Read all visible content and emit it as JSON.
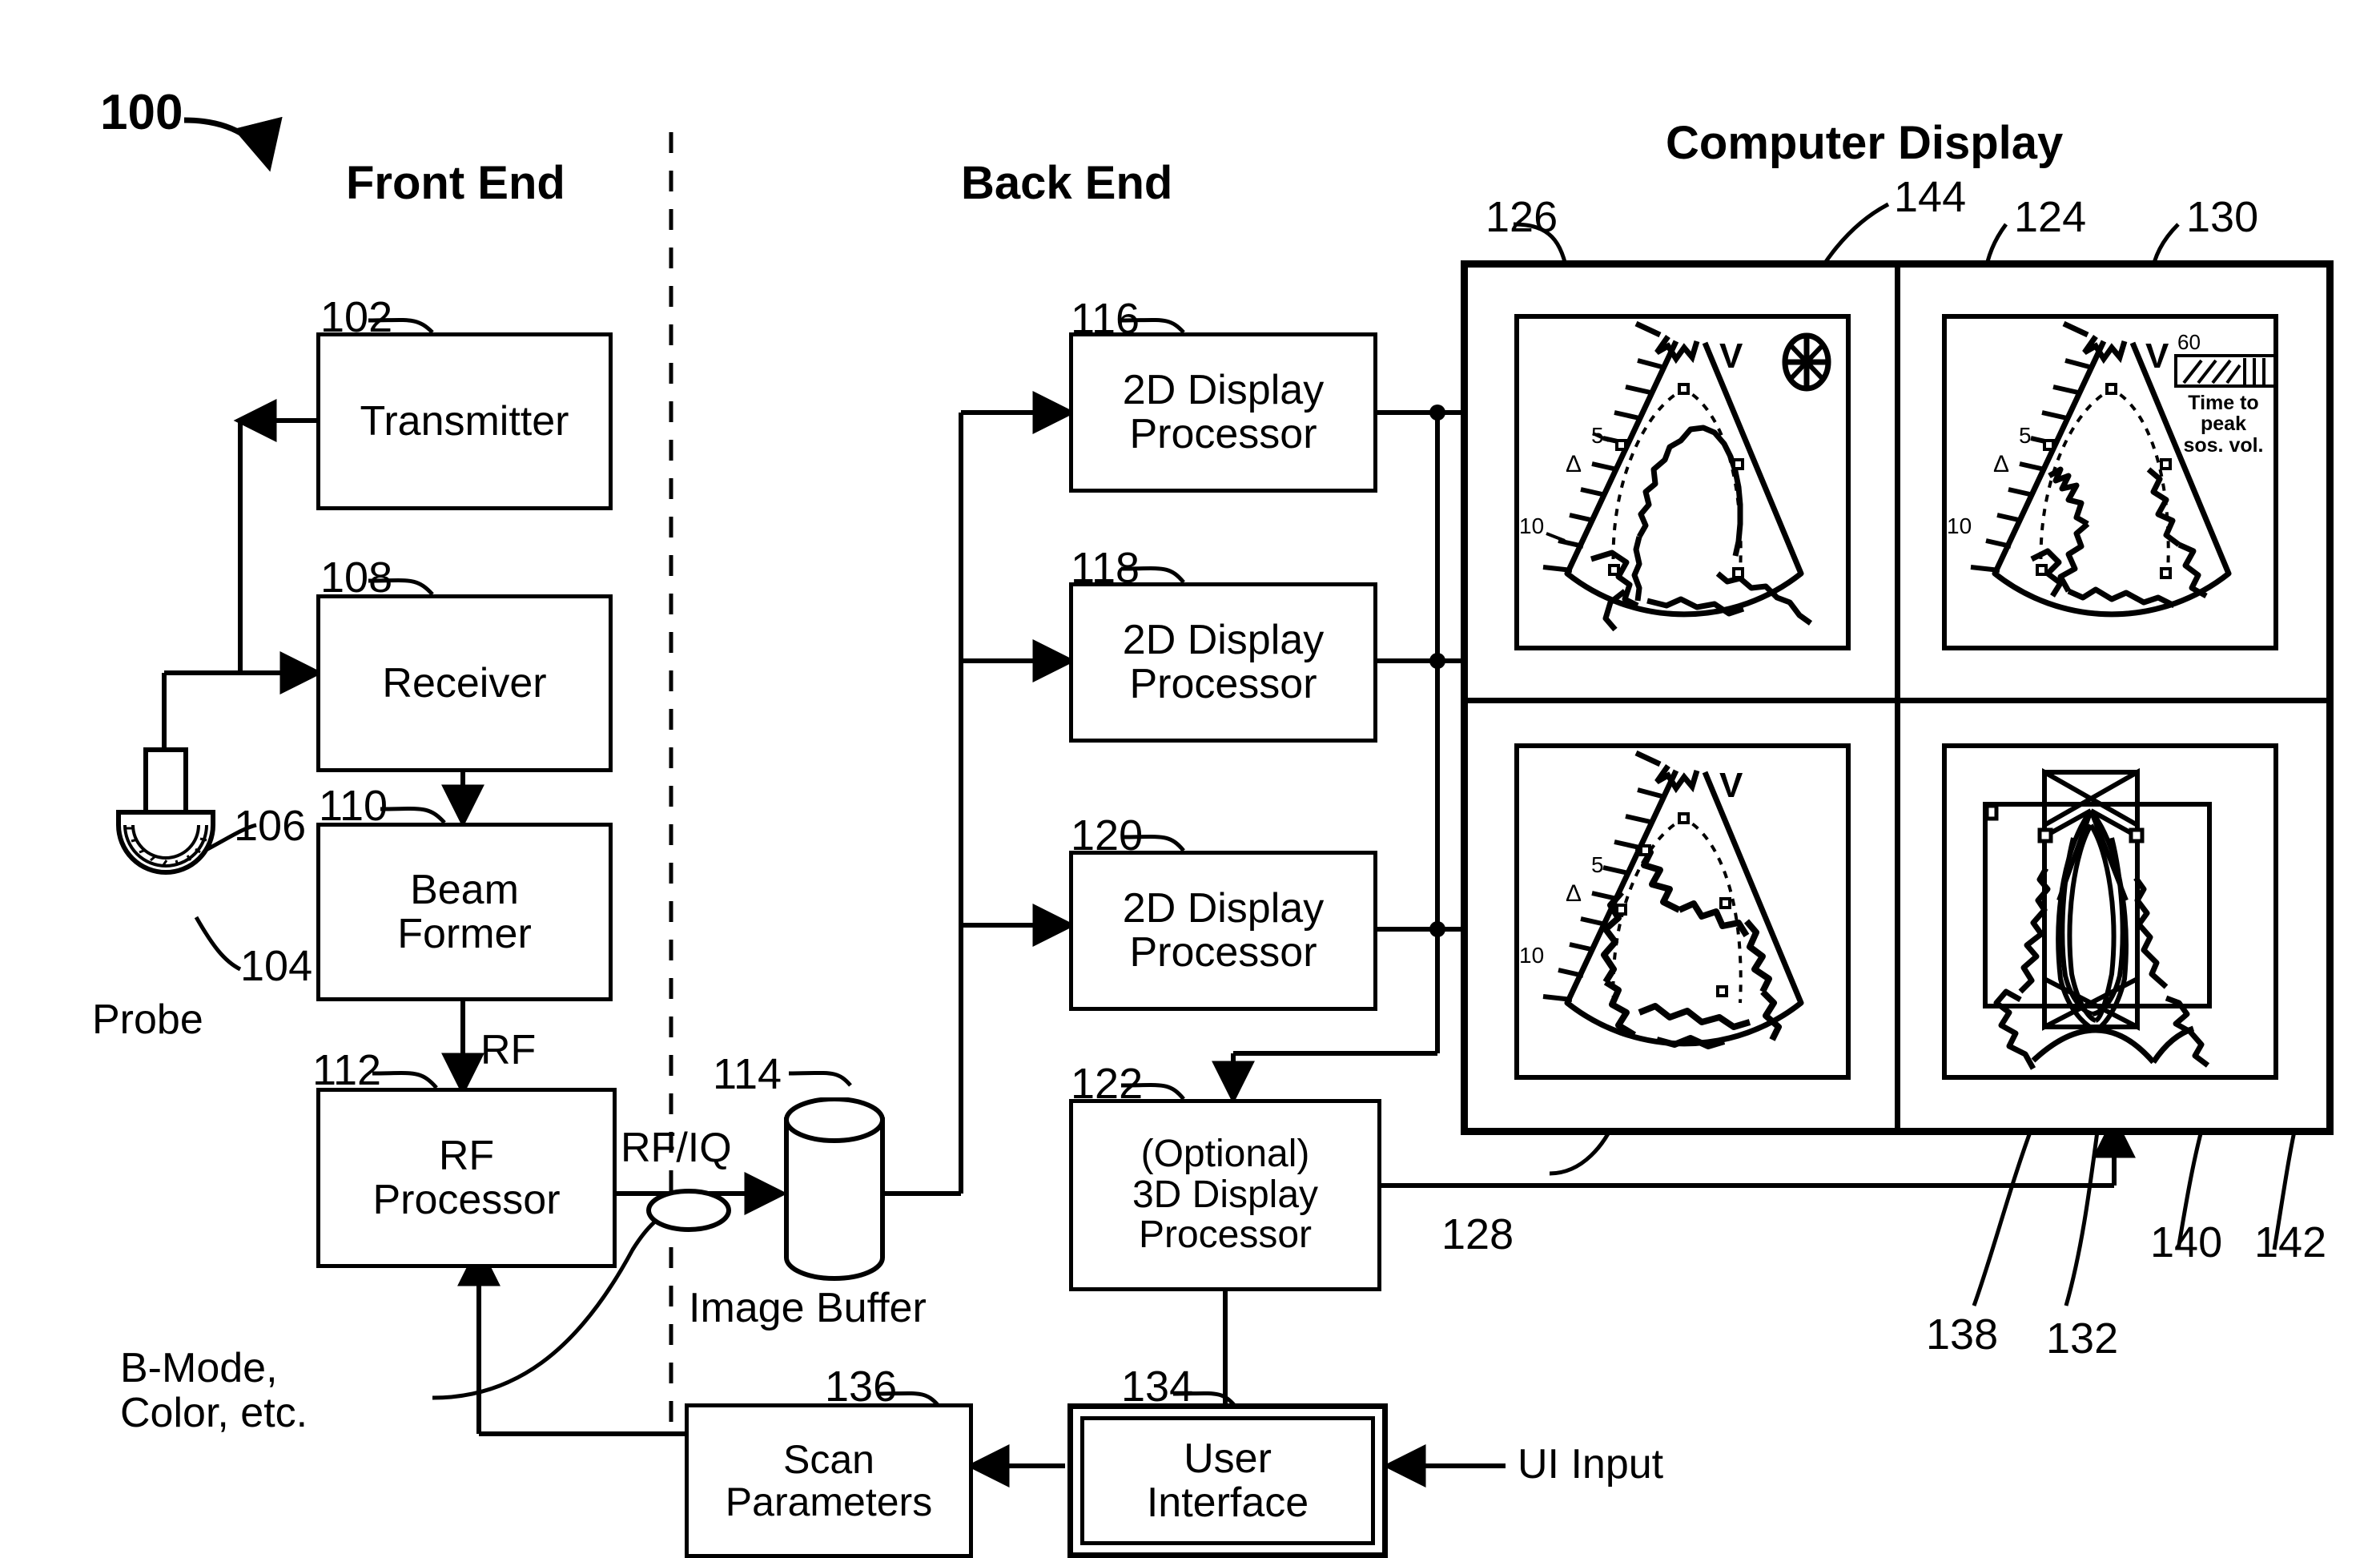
{
  "figure": {
    "number": "100"
  },
  "sections": {
    "front_end": "Front End",
    "back_end": "Back End",
    "computer_display": "Computer Display"
  },
  "blocks": [
    {
      "ref": "102",
      "label": "Transmitter"
    },
    {
      "ref": "108",
      "label": "Receiver"
    },
    {
      "ref": "110",
      "label": "Beam\nFormer"
    },
    {
      "ref": "112",
      "label": "RF\nProcessor"
    },
    {
      "ref": "116",
      "label": "2D Display\nProcessor"
    },
    {
      "ref": "118",
      "label": "2D Display\nProcessor"
    },
    {
      "ref": "120",
      "label": "2D Display\nProcessor"
    },
    {
      "ref": "122",
      "label": "(Optional)\n3D Display\nProcessor"
    },
    {
      "ref": "136",
      "label": "Scan\nParameters"
    },
    {
      "ref": "134",
      "label": "User\nInterface"
    }
  ],
  "labels": {
    "probe": "Probe",
    "probe_ref": "104",
    "probe_cable_ref": "106",
    "image_buffer": "Image Buffer",
    "image_buffer_ref": "114",
    "rf": "RF",
    "rf_iq": "RF/IQ",
    "bmode": "B-Mode,\nColor, etc.",
    "ui_input": "UI Input"
  },
  "display": {
    "ref_outer": "128",
    "ref_quad_top_left": "126",
    "ref_quad_top_right": "124",
    "ref_panel_top_right": "130",
    "ref_rosette_icon": "144",
    "ref_138": "138",
    "ref_132": "132",
    "ref_140": "140",
    "ref_142": "142",
    "panels": [
      {
        "id": "top-left",
        "v_marker": "V",
        "depth_ticks": [
          "5",
          "10"
        ],
        "caliper": "Δ",
        "icon": "rosette-icon"
      },
      {
        "id": "top-right",
        "v_marker": "V",
        "depth_ticks": [
          "5",
          "10"
        ],
        "caliper": "Δ",
        "colorbar_max": "60",
        "colorbar_caption": "Time to peak\nsos. vol."
      },
      {
        "id": "bottom-left",
        "v_marker": "V",
        "depth_ticks": [
          "5",
          "10"
        ],
        "caliper": "Δ"
      },
      {
        "id": "bottom-right",
        "v_marker": "",
        "depth_ticks": [],
        "caliper": ""
      }
    ]
  },
  "colors": {
    "ink": "#000000",
    "paper": "#ffffff"
  }
}
